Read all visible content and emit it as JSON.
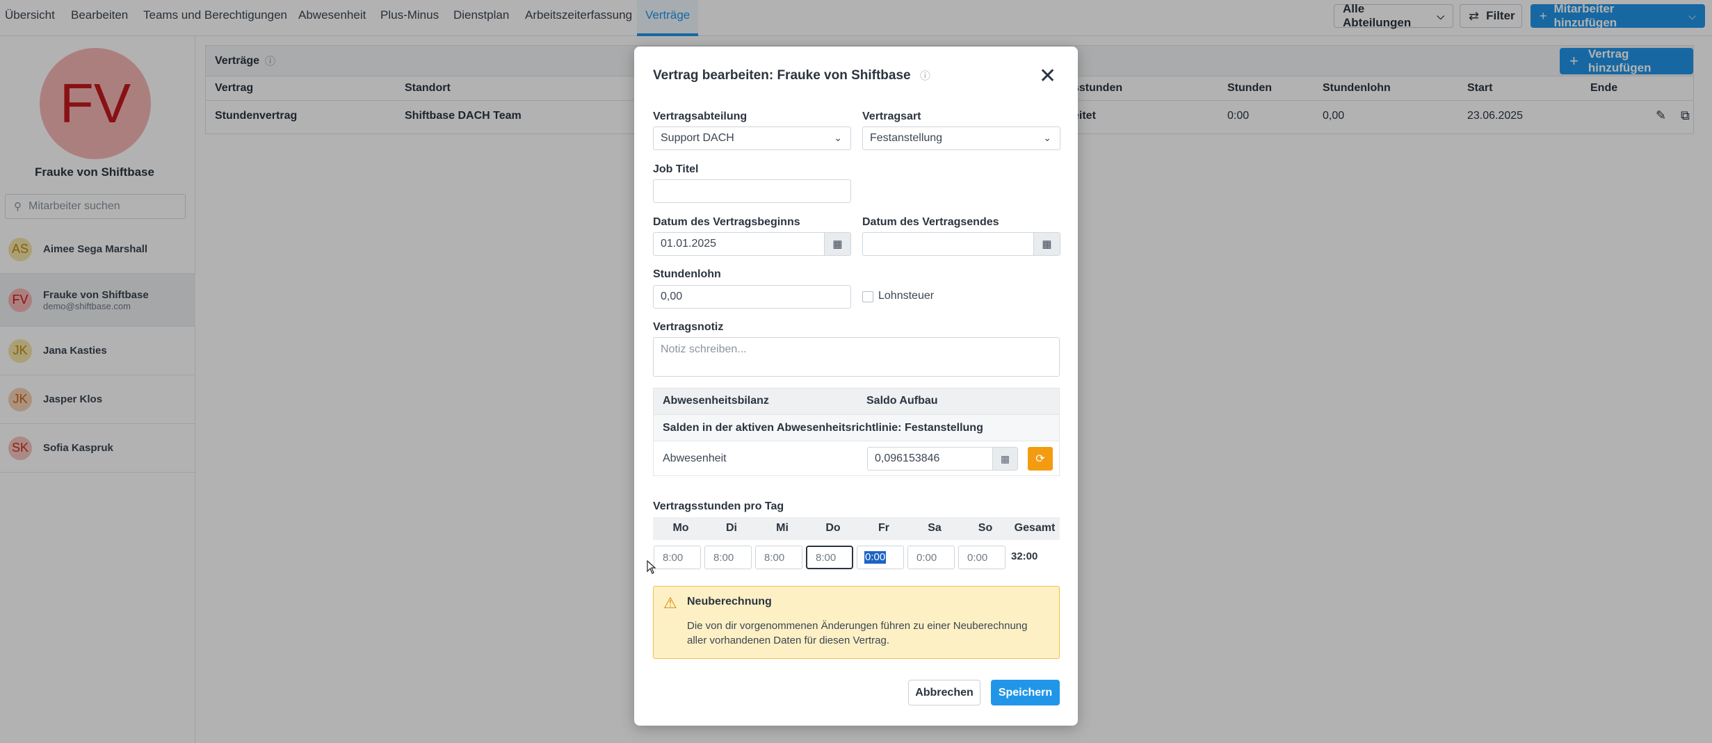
{
  "nav": {
    "tabs": [
      "Übersicht",
      "Bearbeiten",
      "Teams und Berechtigungen",
      "Abwesenheit",
      "Plus-Minus",
      "Dienstplan",
      "Arbeitszeiterfassung",
      "Verträge"
    ],
    "department_filter": "Alle Abteilungen",
    "filter_label": "Filter",
    "add_employee_label": "Mitarbeiter hinzufügen"
  },
  "sidebar": {
    "avatar_initials": "FV",
    "profile_name": "Frauke von Shiftbase",
    "search_placeholder": "Mitarbeiter suchen",
    "employees": [
      {
        "initials": "AS",
        "name": "Aimee Sega Marshall",
        "sub": "",
        "bg": "#f5e6a8",
        "fg": "#b98a10"
      },
      {
        "initials": "FV",
        "name": "Frauke von Shiftbase",
        "sub": "demo@shiftbase.com",
        "bg": "#f6b7b6",
        "fg": "#c3191e"
      },
      {
        "initials": "JK",
        "name": "Jana Kasties",
        "sub": "",
        "bg": "#f5e6a8",
        "fg": "#b98a10"
      },
      {
        "initials": "JK",
        "name": "Jasper Klos",
        "sub": "",
        "bg": "#f7d2b5",
        "fg": "#c8641b"
      },
      {
        "initials": "SK",
        "name": "Sofia Kaspruk",
        "sub": "",
        "bg": "#f7c4c0",
        "fg": "#c8321b"
      }
    ]
  },
  "contracts": {
    "title": "Verträge",
    "add_label": "Vertrag hinzufügen",
    "headers": {
      "contract": "Vertrag",
      "location": "Standort",
      "hours_partial": "sstunden",
      "hours": "Stunden",
      "wage": "Stundenlohn",
      "start": "Start",
      "end": "Ende"
    },
    "row": {
      "contract": "Stundenvertrag",
      "location": "Shiftbase DACH Team",
      "hours_partial": "eitet",
      "hours": "0:00",
      "wage": "0,00",
      "start": "23.06.2025",
      "end": ""
    }
  },
  "modal": {
    "title": "Vertrag bearbeiten: Frauke von Shiftbase",
    "department_label": "Vertragsabteilung",
    "department_value": "Support DACH",
    "type_label": "Vertragsart",
    "type_value": "Festanstellung",
    "job_title_label": "Job Titel",
    "job_title_value": "",
    "start_date_label": "Datum des Vertragsbeginns",
    "start_date_value": "01.01.2025",
    "end_date_label": "Datum des Vertragsendes",
    "end_date_value": "",
    "wage_label": "Stundenlohn",
    "wage_value": "0,00",
    "tax_label": "Lohnsteuer",
    "note_label": "Vertragsnotiz",
    "note_placeholder": "Notiz schreiben...",
    "absence": {
      "col1": "Abwesenheitsbilanz",
      "col2": "Saldo Aufbau",
      "policy_text": "Salden in der aktiven Abwesenheitsrichtlinie: Festanstellung",
      "row_name": "Abwesenheit",
      "row_value": "0,096153846"
    },
    "hours_label": "Vertragsstunden pro Tag",
    "days": [
      "Mo",
      "Di",
      "Mi",
      "Do",
      "Fr",
      "Sa",
      "So"
    ],
    "total_label": "Gesamt",
    "day_values": [
      "8:00",
      "8:00",
      "8:00",
      "8:00",
      "0:00",
      "0:00",
      "0:00"
    ],
    "total_value": "32:00",
    "warning_title": "Neuberechnung",
    "warning_text": "Die von dir vorgenommenen Änderungen führen zu einer Neuberechnung aller vorhandenen Daten für diesen Vertrag.",
    "cancel_label": "Abbrechen",
    "save_label": "Speichern"
  },
  "colors": {
    "accent": "#2196e8",
    "warning_bg": "#fdf0c4",
    "reset_button": "#f39c12"
  }
}
